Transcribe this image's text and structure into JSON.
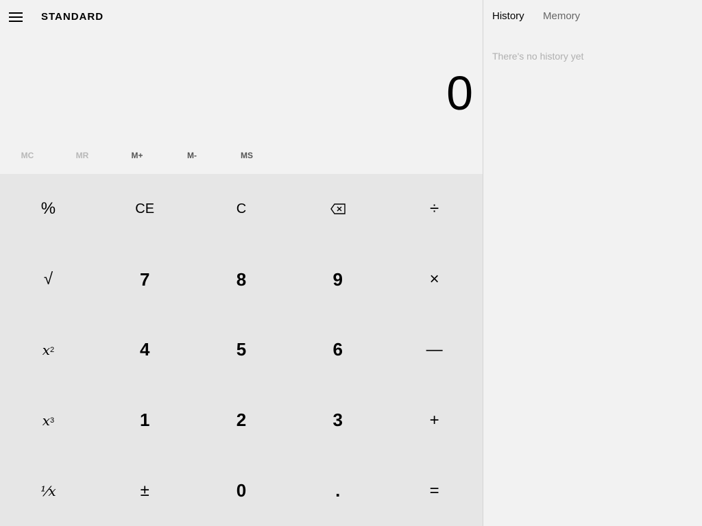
{
  "header": {
    "menu_icon": "hamburger-menu-icon",
    "mode_title": "STANDARD"
  },
  "display": {
    "value": "0"
  },
  "memory": {
    "buttons": [
      {
        "label": "MC",
        "enabled": false
      },
      {
        "label": "MR",
        "enabled": false
      },
      {
        "label": "M+",
        "enabled": true
      },
      {
        "label": "M-",
        "enabled": true
      },
      {
        "label": "MS",
        "enabled": true
      }
    ]
  },
  "keypad": {
    "percent": "%",
    "clear_entry": "CE",
    "clear": "C",
    "backspace_icon": "backspace-icon",
    "divide": "÷",
    "sqrt": "√",
    "seven": "7",
    "eight": "8",
    "nine": "9",
    "multiply": "×",
    "square_base": "x",
    "square_exp": "2",
    "four": "4",
    "five": "5",
    "six": "6",
    "minus": "—",
    "cube_base": "x",
    "cube_exp": "3",
    "one": "1",
    "two": "2",
    "three": "3",
    "plus": "+",
    "reciprocal": "¹⁄x",
    "negate": "±",
    "zero": "0",
    "decimal": ".",
    "equals": "="
  },
  "side_panel": {
    "tabs": [
      {
        "label": "History",
        "active": true
      },
      {
        "label": "Memory",
        "active": false
      }
    ],
    "empty_message": "There's no history yet"
  },
  "colors": {
    "background": "#f2f2f2",
    "keypad_background": "#e6e6e6",
    "disabled_text": "#b8b8b8"
  }
}
